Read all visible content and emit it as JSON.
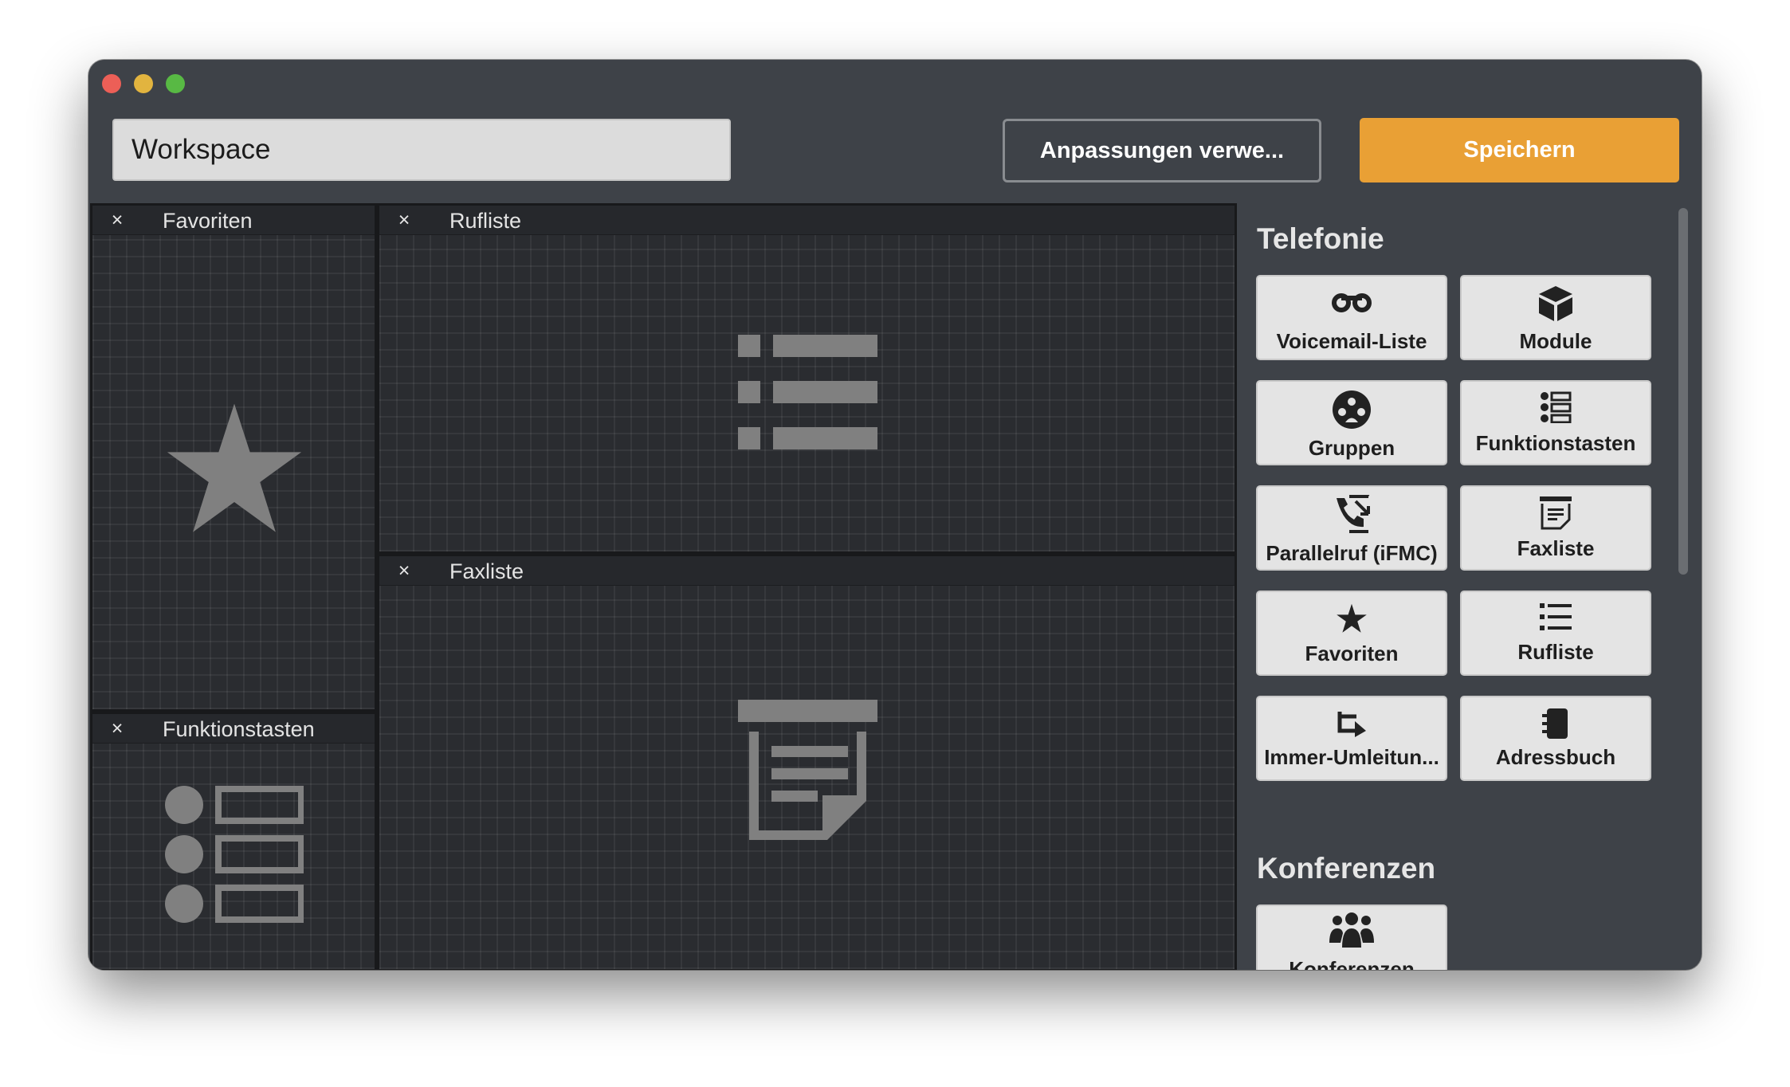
{
  "window": {
    "title": ""
  },
  "toolbar": {
    "workspace_value": "Workspace",
    "reset_label": "Anpassungen verwe...",
    "save_label": "Speichern"
  },
  "panels": {
    "favoriten": {
      "title": "Favoriten",
      "close": "×",
      "icon": "star-icon"
    },
    "rufliste": {
      "title": "Rufliste",
      "close": "×",
      "icon": "list-icon"
    },
    "faxliste": {
      "title": "Faxliste",
      "close": "×",
      "icon": "fax-icon"
    },
    "funktionstasten": {
      "title": "Funktionstasten",
      "close": "×",
      "icon": "function-keys-icon"
    }
  },
  "sidebar": {
    "telefonie": {
      "title": "Telefonie",
      "tiles": [
        {
          "label": "Voicemail-Liste",
          "icon": "voicemail-icon"
        },
        {
          "label": "Module",
          "icon": "cube-icon"
        },
        {
          "label": "Gruppen",
          "icon": "group-icon"
        },
        {
          "label": "Funktionstasten",
          "icon": "function-keys-icon"
        },
        {
          "label": "Parallelruf (iFMC)",
          "icon": "parallel-call-icon"
        },
        {
          "label": "Faxliste",
          "icon": "fax-icon"
        },
        {
          "label": "Favoriten",
          "icon": "star-icon"
        },
        {
          "label": "Rufliste",
          "icon": "list-icon"
        },
        {
          "label": "Immer-Umleitun...",
          "icon": "forward-icon"
        },
        {
          "label": "Adressbuch",
          "icon": "address-book-icon"
        }
      ]
    },
    "konferenzen": {
      "title": "Konferenzen",
      "tiles": [
        {
          "label": "Konferenzen",
          "icon": "conference-icon"
        }
      ]
    }
  },
  "colors": {
    "accent": "#e9a035",
    "window_bg": "#3e4248",
    "canvas_bg": "#2a2c30",
    "tile_bg": "#e4e4e4"
  }
}
